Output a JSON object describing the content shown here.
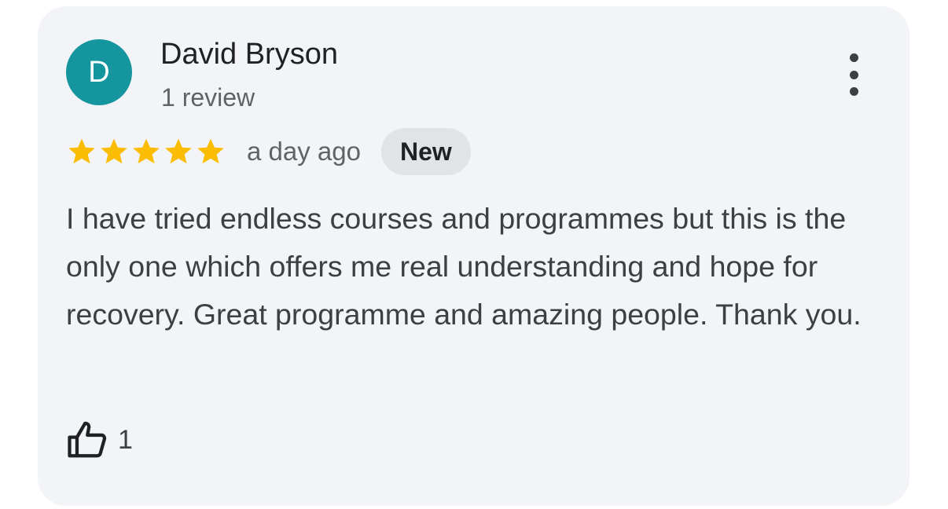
{
  "review": {
    "author": {
      "initial": "D",
      "name": "David Bryson",
      "subtitle": "1 review",
      "avatar_color": "#15969e"
    },
    "menu_icon": "more-vertical-icon",
    "rating": 5,
    "rating_max": 5,
    "star_color": "#fbbc04",
    "time_ago": "a day ago",
    "badge": "New",
    "text": "I have tried endless courses and programmes but this is the only one which offers me real understanding and hope for recovery. Great programme and amazing people. Thank you.",
    "like_icon": "thumbs-up-icon",
    "like_count": "1"
  }
}
